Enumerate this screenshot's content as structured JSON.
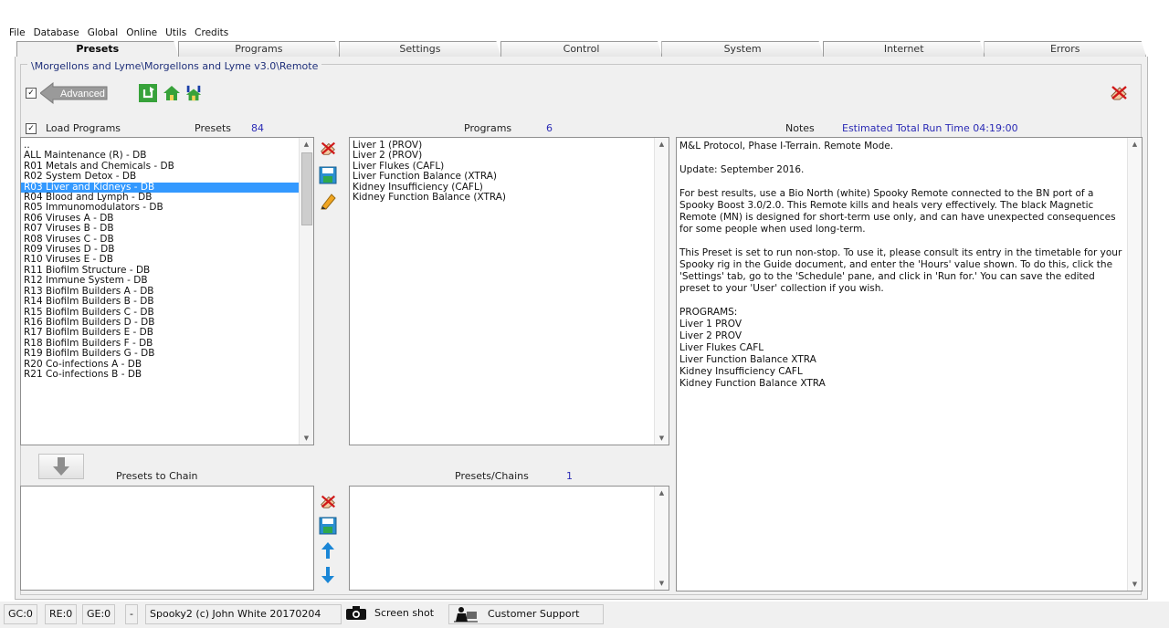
{
  "menu": [
    "File",
    "Database",
    "Global",
    "Online",
    "Utils",
    "Credits"
  ],
  "tabs": [
    "Presets",
    "Programs",
    "Settings",
    "Control",
    "System",
    "Internet",
    "Errors"
  ],
  "path": "\\Morgellons and Lyme\\Morgellons and Lyme v3.0\\Remote",
  "toolbar": {
    "advanced_label": "Advanced",
    "advanced_checked": true
  },
  "presets": {
    "load_label": "Load Programs",
    "load_checked": true,
    "title": "Presets",
    "count": "84",
    "selected_index": 4,
    "items": [
      "..",
      "ALL Maintenance (R) - DB",
      "R01 Metals and Chemicals - DB",
      "R02 System Detox - DB",
      "R03 Liver and Kidneys - DB",
      "R04 Blood and Lymph - DB",
      "R05 Immunomodulators - DB",
      "R06 Viruses A - DB",
      "R07 Viruses B - DB",
      "R08 Viruses C - DB",
      "R09 Viruses D - DB",
      "R10 Viruses E - DB",
      "R11 Biofilm Structure - DB",
      "R12 Immune System - DB",
      "R13 Biofilm Builders A - DB",
      "R14 Biofilm Builders B - DB",
      "R15 Biofilm Builders C - DB",
      "R16 Biofilm Builders D - DB",
      "R17 Biofilm Builders E - DB",
      "R18 Biofilm Builders F - DB",
      "R19 Biofilm Builders G - DB",
      "R20 Co-infections A - DB",
      "R21 Co-infections B - DB"
    ]
  },
  "programs": {
    "title": "Programs",
    "count": "6",
    "items": [
      "Liver 1 (PROV)",
      "Liver 2 (PROV)",
      "Liver Flukes (CAFL)",
      "Liver Function Balance (XTRA)",
      "Kidney Insufficiency (CAFL)",
      "Kidney Function Balance (XTRA)"
    ]
  },
  "notes": {
    "title": "Notes",
    "runtime": "Estimated Total Run Time 04:19:00",
    "paragraphs": [
      "M&L Protocol, Phase I-Terrain. Remote Mode.",
      "Update: September 2016.",
      "For best results, use a Bio North (white) Spooky Remote connected to the BN port of a Spooky Boost 3.0/2.0. This Remote kills and heals very effectively. The black Magnetic Remote (MN) is designed for short-term use only, and can have unexpected consequences for some people when used long-term.",
      "This Preset is set to run non-stop. To use it, please consult its entry in the timetable for your Spooky rig in the Guide document, and enter the 'Hours' value shown. To do this, click the 'Settings' tab, go to the 'Schedule' pane, and click in 'Run for.' You can save the edited preset to your 'User' collection if you wish.",
      "PROGRAMS:\nLiver 1 PROV\nLiver 2 PROV\nLiver Flukes CAFL\nLiver Function Balance XTRA\nKidney Insufficiency CAFL\nKidney Function Balance XTRA"
    ]
  },
  "chain": {
    "presets_to_chain_label": "Presets to Chain",
    "presets_chains_label": "Presets/Chains",
    "presets_chains_count": "1"
  },
  "status": {
    "gc": "GC:0",
    "re": "RE:0",
    "ge": "GE:0",
    "dash": "-",
    "copyright": "Spooky2 (c) John White 20170204",
    "screenshot": "Screen shot",
    "support": "Customer Support"
  },
  "colors": {
    "selection": "#3399ff",
    "count": "#2b2bb5",
    "path": "#1f2f7a",
    "accent_green": "#37a23a",
    "accent_blue": "#1a86d6"
  }
}
